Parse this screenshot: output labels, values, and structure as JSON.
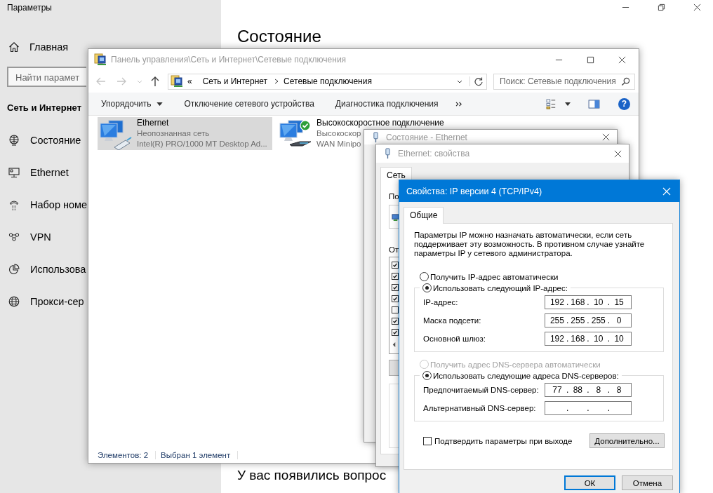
{
  "settings": {
    "title": "Параметры",
    "home": "Главная",
    "search_placeholder": "Найти парамет",
    "section": "Сеть и Интернет",
    "heading": "Состояние",
    "question": "У вас появились вопрос",
    "nav": [
      {
        "label": "Состояние"
      },
      {
        "label": "Ethernet"
      },
      {
        "label": "Набор номе"
      },
      {
        "label": "VPN"
      },
      {
        "label": "Использова"
      },
      {
        "label": "Прокси-сер"
      }
    ]
  },
  "explorer": {
    "title": "Панель управления\\Сеть и Интернет\\Сетевые подключения",
    "address_prefix": "«",
    "breadcrumb": [
      "Сеть и Интернет",
      "Сетевые подключения"
    ],
    "search_placeholder": "Поиск: Сетевые подключения",
    "help_label": "?",
    "commands": [
      {
        "label": "Упорядочить",
        "kind": "menu"
      },
      {
        "label": "Отключение сетевого устройства",
        "kind": "plain"
      },
      {
        "label": "Диагностика подключения",
        "kind": "plain"
      }
    ],
    "connections": [
      {
        "name": "Ethernet",
        "status": "Неопознанная сеть",
        "device": "Intel(R) PRO/1000 MT Desktop Ad...",
        "kind": "ethernet",
        "selected": true,
        "connected": false
      },
      {
        "name": "Высокоскоростное подключение",
        "status": "Высокоскор",
        "device": "WAN Minipo",
        "kind": "wan",
        "selected": false,
        "connected": true
      }
    ],
    "status_bar": [
      "Элементов: 2",
      "Выбран 1 элемент"
    ]
  },
  "status_window": {
    "title": "Состояние - Ethernet"
  },
  "properties_window": {
    "title": "Ethernet: свойства",
    "tabs": [
      {
        "label": "Сеть",
        "selected": true
      }
    ],
    "connect_label": "По",
    "components_label": "От",
    "components": [
      {
        "checked": true
      },
      {
        "checked": true
      },
      {
        "checked": true
      },
      {
        "checked": true
      },
      {
        "checked": false
      },
      {
        "checked": true
      },
      {
        "checked": true
      }
    ]
  },
  "ipv4_dialog": {
    "title": "Свойства: IP версии 4 (TCP/IPv4)",
    "tabs": [
      {
        "label": "Общие",
        "selected": true
      }
    ],
    "description": "Параметры IP можно назначать автоматически, если сеть поддерживает эту возможность. В противном случае узнайте параметры IP у сетевого администратора.",
    "separator": ".",
    "ip_mode": [
      {
        "label": "Получить IP-адрес автоматически",
        "selected": false,
        "disabled": false
      },
      {
        "label": "Использовать следующий IP-адрес:",
        "selected": true,
        "disabled": false
      }
    ],
    "ip_fields": [
      {
        "label": "IP-адрес:",
        "octets": [
          "192",
          "168",
          "10",
          "15"
        ]
      },
      {
        "label": "Маска подсети:",
        "octets": [
          "255",
          "255",
          "255",
          "0"
        ]
      },
      {
        "label": "Основной шлюз:",
        "octets": [
          "192",
          "168",
          "10",
          "10"
        ]
      }
    ],
    "dns_mode": [
      {
        "label": "Получить адрес DNS-сервера автоматически",
        "selected": false,
        "disabled": true
      },
      {
        "label": "Использовать следующие адреса DNS-серверов:",
        "selected": true,
        "disabled": false
      }
    ],
    "dns_fields": [
      {
        "label": "Предпочитаемый DNS-сервер:",
        "octets": [
          "77",
          "88",
          "8",
          "8"
        ]
      },
      {
        "label": "Альтернативный DNS-сервер:"
      }
    ],
    "validate": {
      "label": "Подтвердить параметры при выходе",
      "checked": false
    },
    "advanced": "Дополнительно...",
    "buttons": [
      {
        "label": "ОК",
        "default": true
      },
      {
        "label": "Отмена",
        "default": false
      }
    ]
  }
}
